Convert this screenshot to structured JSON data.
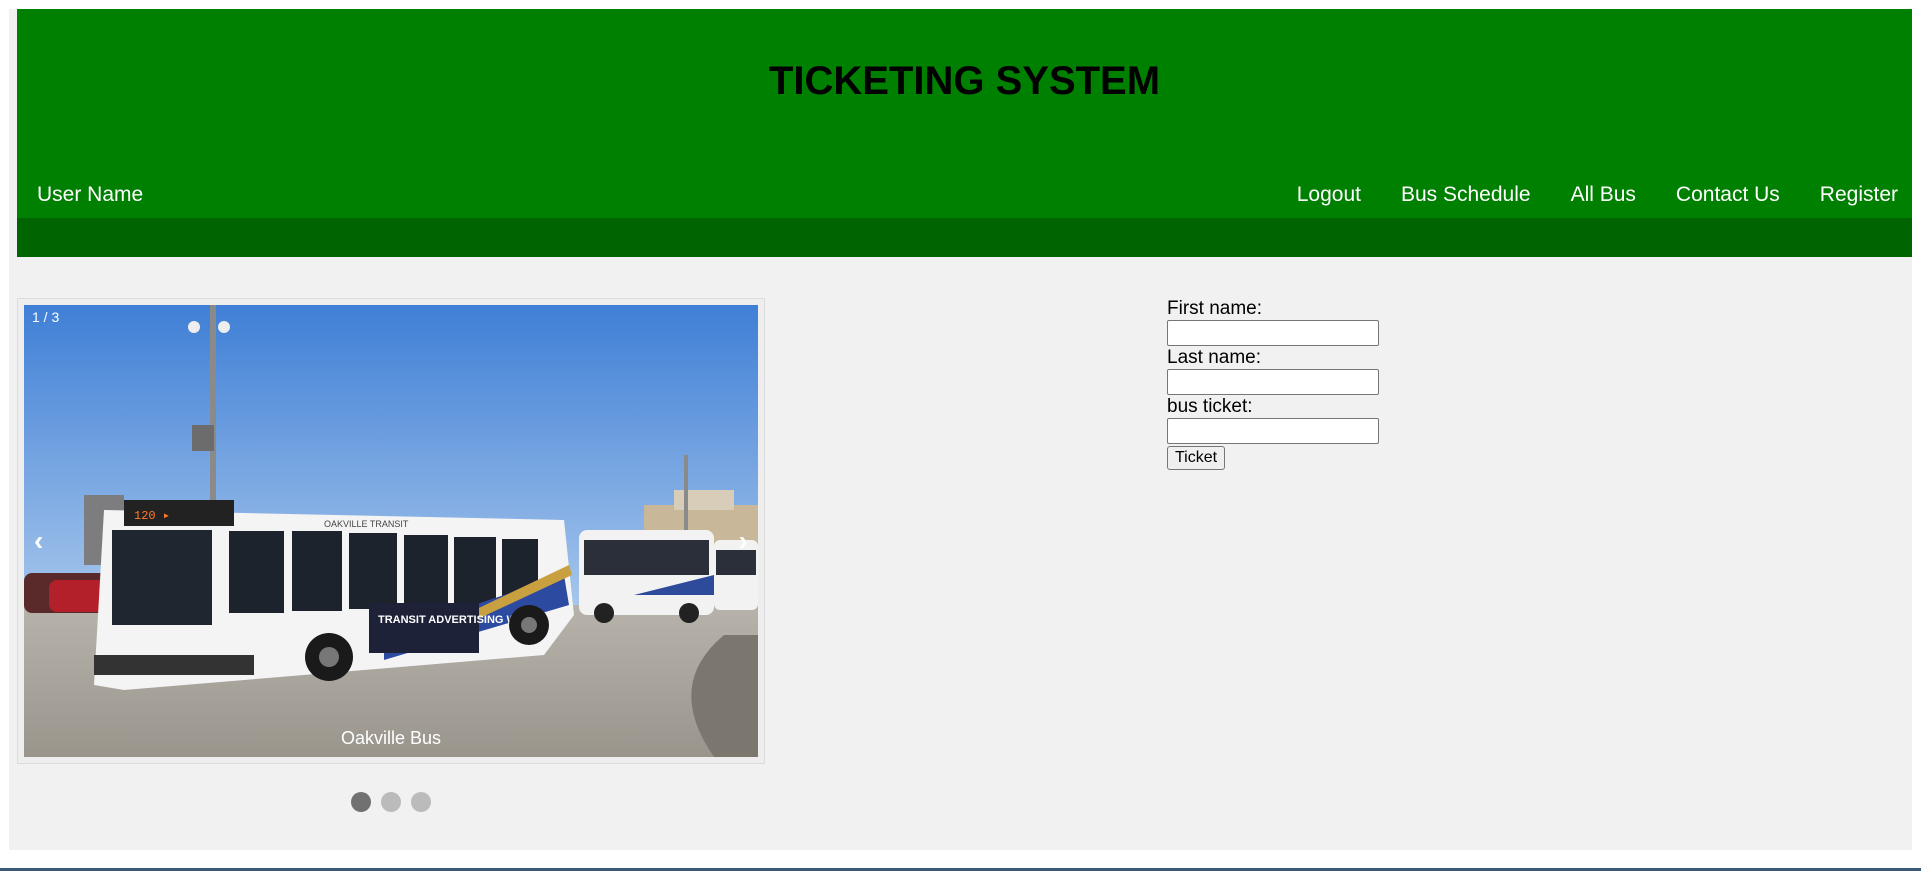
{
  "header": {
    "title": "TICKETING SYSTEM",
    "user_name": "User Name",
    "nav": [
      {
        "label": "Logout"
      },
      {
        "label": "Bus Schedule"
      },
      {
        "label": "All Bus"
      },
      {
        "label": "Contact Us"
      },
      {
        "label": "Register"
      }
    ]
  },
  "slideshow": {
    "slide_number": "1 / 3",
    "caption": "Oakville Bus",
    "prev_icon": "‹",
    "next_icon": "›",
    "dots": 3,
    "active_dot": 1,
    "bus_signage": "OAKVILLE TRANSIT",
    "ad_text": "TRANSIT ADVERTISING WORKS"
  },
  "form": {
    "first_name_label": "First name:",
    "last_name_label": "Last name:",
    "bus_ticket_label": "bus ticket:",
    "first_name_value": "",
    "last_name_value": "",
    "bus_ticket_value": "",
    "submit_label": "Ticket"
  },
  "colors": {
    "header_green": "#008000",
    "subbar_green": "#006400",
    "page_bg": "#f1f1f1"
  }
}
